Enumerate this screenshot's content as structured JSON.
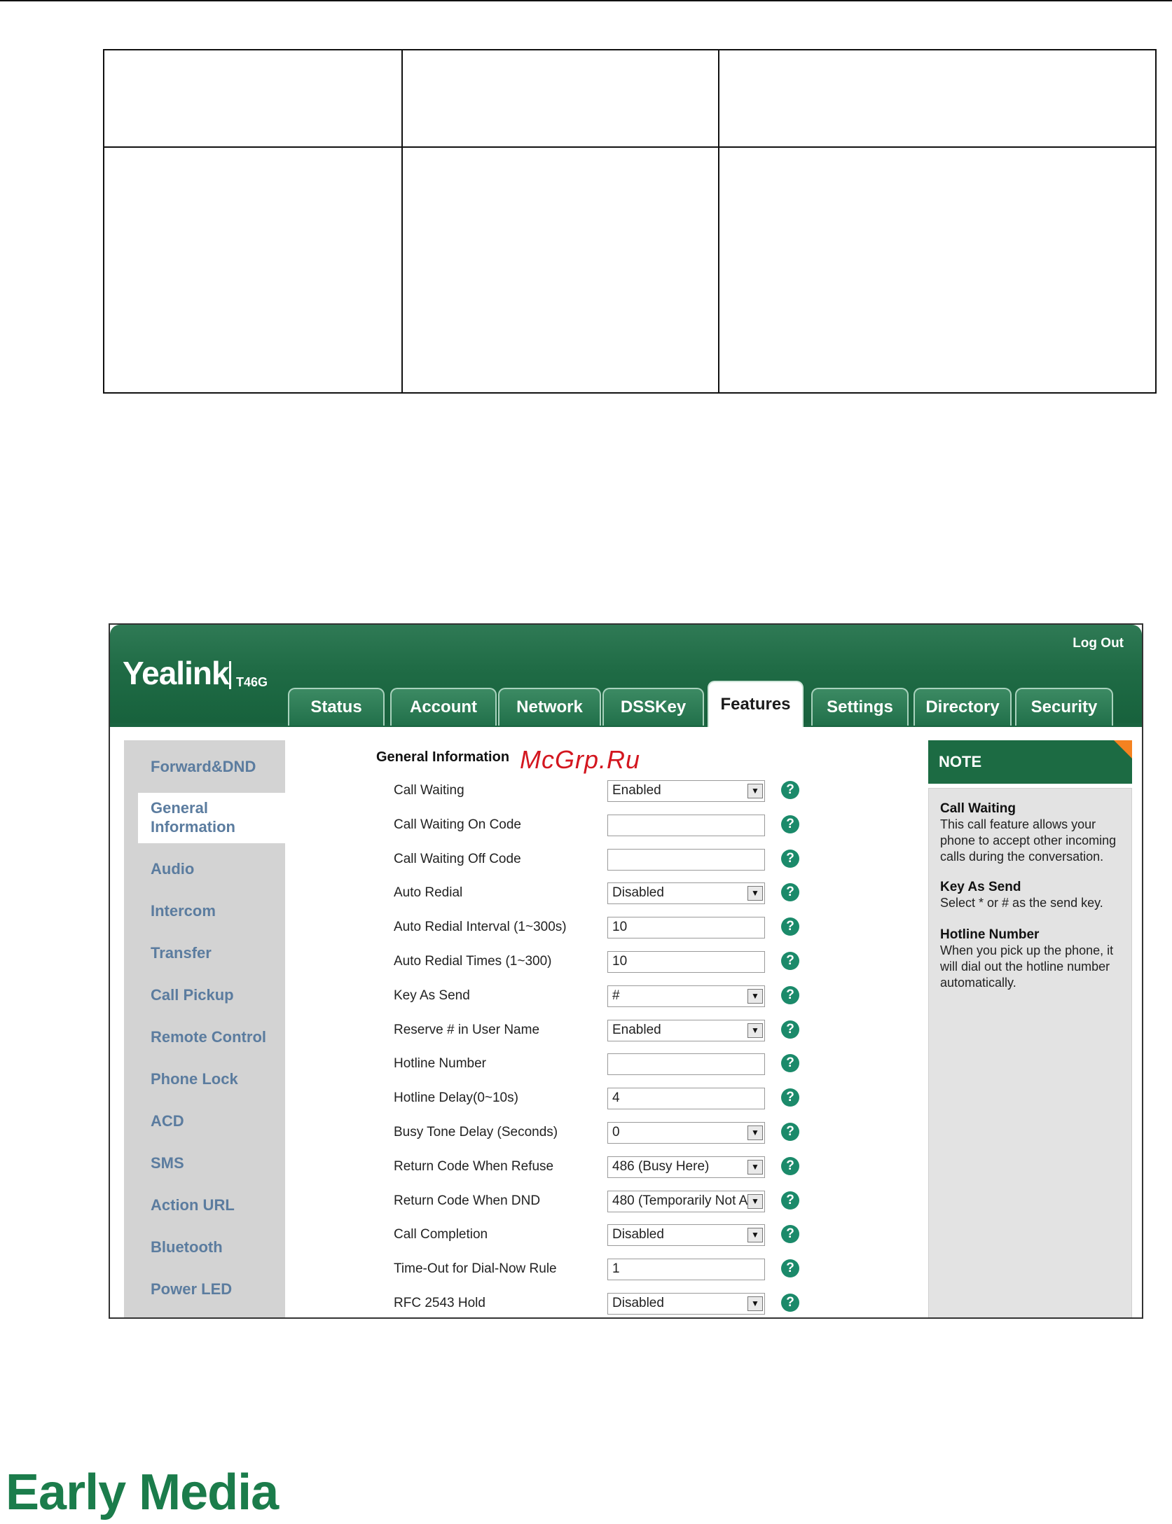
{
  "brand": {
    "name": "Yealink",
    "model": "T46G"
  },
  "header": {
    "logout": "Log Out"
  },
  "tabs": [
    {
      "label": "Status"
    },
    {
      "label": "Account"
    },
    {
      "label": "Network"
    },
    {
      "label": "DSSKey"
    },
    {
      "label": "Features",
      "active": true
    },
    {
      "label": "Settings"
    },
    {
      "label": "Directory"
    },
    {
      "label": "Security"
    }
  ],
  "sidebar": {
    "items": [
      {
        "label": "Forward&DND"
      },
      {
        "label": "General Information",
        "active": true
      },
      {
        "label": "Audio"
      },
      {
        "label": "Intercom"
      },
      {
        "label": "Transfer"
      },
      {
        "label": "Call Pickup"
      },
      {
        "label": "Remote Control"
      },
      {
        "label": "Phone Lock"
      },
      {
        "label": "ACD"
      },
      {
        "label": "SMS"
      },
      {
        "label": "Action URL"
      },
      {
        "label": "Bluetooth"
      },
      {
        "label": "Power LED"
      }
    ]
  },
  "section": {
    "title": "General Information"
  },
  "watermark": "McGrp.Ru",
  "rows": [
    {
      "label": "Call Waiting",
      "type": "select",
      "value": "Enabled"
    },
    {
      "label": "Call Waiting On Code",
      "type": "input",
      "value": ""
    },
    {
      "label": "Call Waiting Off Code",
      "type": "input",
      "value": ""
    },
    {
      "label": "Auto Redial",
      "type": "select",
      "value": "Disabled"
    },
    {
      "label": "Auto Redial Interval (1~300s)",
      "type": "input",
      "value": "10"
    },
    {
      "label": "Auto Redial Times (1~300)",
      "type": "input",
      "value": "10"
    },
    {
      "label": "Key As Send",
      "type": "select",
      "value": "#"
    },
    {
      "label": "Reserve # in User Name",
      "type": "select",
      "value": "Enabled"
    },
    {
      "label": "Hotline Number",
      "type": "input",
      "value": ""
    },
    {
      "label": "Hotline Delay(0~10s)",
      "type": "input",
      "value": "4"
    },
    {
      "label": "Busy Tone Delay (Seconds)",
      "type": "select",
      "value": "0"
    },
    {
      "label": "Return Code When Refuse",
      "type": "select",
      "value": "486 (Busy Here)"
    },
    {
      "label": "Return Code When DND",
      "type": "select",
      "value": "480 (Temporarily Not A"
    },
    {
      "label": "Call Completion",
      "type": "select",
      "value": "Disabled"
    },
    {
      "label": "Time-Out for Dial-Now Rule",
      "type": "input",
      "value": "1"
    },
    {
      "label": "RFC 2543 Hold",
      "type": "select",
      "value": "Disabled"
    }
  ],
  "note": {
    "heading": "NOTE",
    "items": [
      {
        "title": "Call Waiting",
        "text": "This call feature allows your phone to accept other incoming calls during the conversation."
      },
      {
        "title": "Key As Send",
        "text": "Select * or # as the send key."
      },
      {
        "title": "Hotline Number",
        "text": "When you pick up the phone, it will dial out the hotline number automatically."
      }
    ]
  },
  "footer": {
    "heading": "Early Media"
  },
  "icons": {
    "help": "help-icon",
    "dropdown": "dropdown-arrow-icon"
  },
  "colors": {
    "brand_green": "#1f6b45",
    "help": "#1b8a6a",
    "sidebar_link": "#5b7c9f",
    "heading_green": "#1b7c4b",
    "note_accent": "#f58220"
  }
}
